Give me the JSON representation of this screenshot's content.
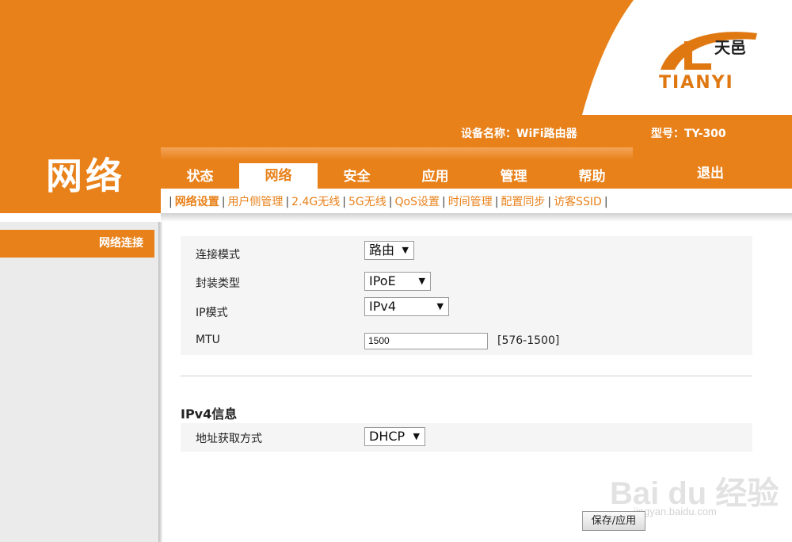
{
  "header": {
    "brand_cn": "天邑",
    "brand_en": "TIANYI",
    "page_title": "网络",
    "device_name": "设备名称：WiFi路由器",
    "model": "型号：TY-300",
    "logout": "退出"
  },
  "main_tabs": [
    {
      "label": "状态",
      "active": false
    },
    {
      "label": "网络",
      "active": true
    },
    {
      "label": "安全",
      "active": false
    },
    {
      "label": "应用",
      "active": false
    },
    {
      "label": "管理",
      "active": false
    },
    {
      "label": "帮助",
      "active": false
    }
  ],
  "sub_nav": [
    {
      "label": "网络设置",
      "active": true
    },
    {
      "label": "用户侧管理"
    },
    {
      "label": "2.4G无线"
    },
    {
      "label": "5G无线"
    },
    {
      "label": "QoS设置"
    },
    {
      "label": "时间管理"
    },
    {
      "label": "配置同步"
    },
    {
      "label": "访客SSID"
    }
  ],
  "sidebar": {
    "items": [
      {
        "label": "网络连接",
        "active": true
      }
    ]
  },
  "form": {
    "connection_mode": {
      "label": "连接模式",
      "value": "路由"
    },
    "encapsulation": {
      "label": "封装类型",
      "value": "IPoE"
    },
    "ip_mode": {
      "label": "IP模式",
      "value": "IPv4"
    },
    "mtu": {
      "label": "MTU",
      "value": "1500",
      "range": "[576-1500]"
    }
  },
  "ipv4": {
    "title": "IPv4信息",
    "address_mode": {
      "label": "地址获取方式",
      "value": "DHCP"
    }
  },
  "buttons": {
    "save": "保存/应用"
  },
  "watermark": {
    "text": "Bai du 经验",
    "url": "jingyan.baidu.com"
  },
  "colors": {
    "accent": "#e8811a",
    "sidebar_bg": "#ebebeb",
    "form_bg": "#f5f5f5"
  },
  "icons": {
    "dropdown": "triangle-down"
  }
}
